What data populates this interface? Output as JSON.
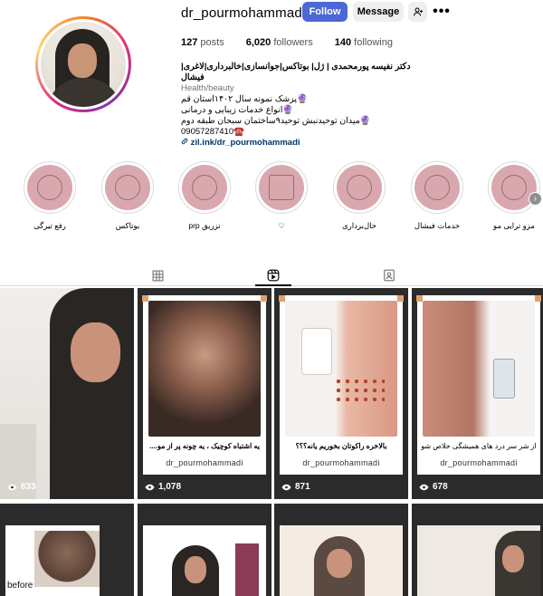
{
  "profile": {
    "username": "dr_pourmohammadi",
    "follow_label": "Follow",
    "message_label": "Message",
    "posts_count": "127",
    "posts_label": "posts",
    "followers_count": "6,020",
    "followers_label": "followers",
    "following_count": "140",
    "following_label": "following"
  },
  "bio": {
    "name": "دکتر نفیسه پورمحمدی | ژل| بوتاکس|جوانسازی|خالبرداری|لاغری|فیشال",
    "category": "Health/beauty",
    "line1": "🔮پزشک نمونه سال ۱۴۰۲استان قم",
    "line2": "🔮انواع خدمات زیبایی و درمانی",
    "line3": "🔮میدان توحیدنبش توحید۹ساختمان سبحان طبقه دوم",
    "phone": "09057287410☎️",
    "link": "zil.ink/dr_pourmohammadi"
  },
  "highlights": [
    {
      "label": "رفع تیرگی"
    },
    {
      "label": "بوتاکس"
    },
    {
      "label": "تزریق prp"
    },
    {
      "label": "♡"
    },
    {
      "label": "خال‌برداری"
    },
    {
      "label": "خدمات فیشال"
    },
    {
      "label": "مزو ترایی مو"
    }
  ],
  "posts": [
    {
      "caption": "",
      "handle": "",
      "views": "633"
    },
    {
      "caption": "یه اشتباه کوچیک ، یه چونه پر از مو....",
      "handle": "dr_pourmohammadi",
      "views": "1,078"
    },
    {
      "caption": "بالاخره راکوتان بخوریم یانه؟؟؟",
      "handle": "dr_pourmohammadi",
      "views": "871"
    },
    {
      "caption": "از شر سر درد های همیشگی خلاص شو",
      "handle": "dr_pourmohammadi",
      "views": "678"
    }
  ],
  "row2": {
    "before_label": "before"
  },
  "colors": {
    "follow_button": "#4c68d7",
    "highlight_fill": "#d9a8ae",
    "link": "#00376b"
  }
}
